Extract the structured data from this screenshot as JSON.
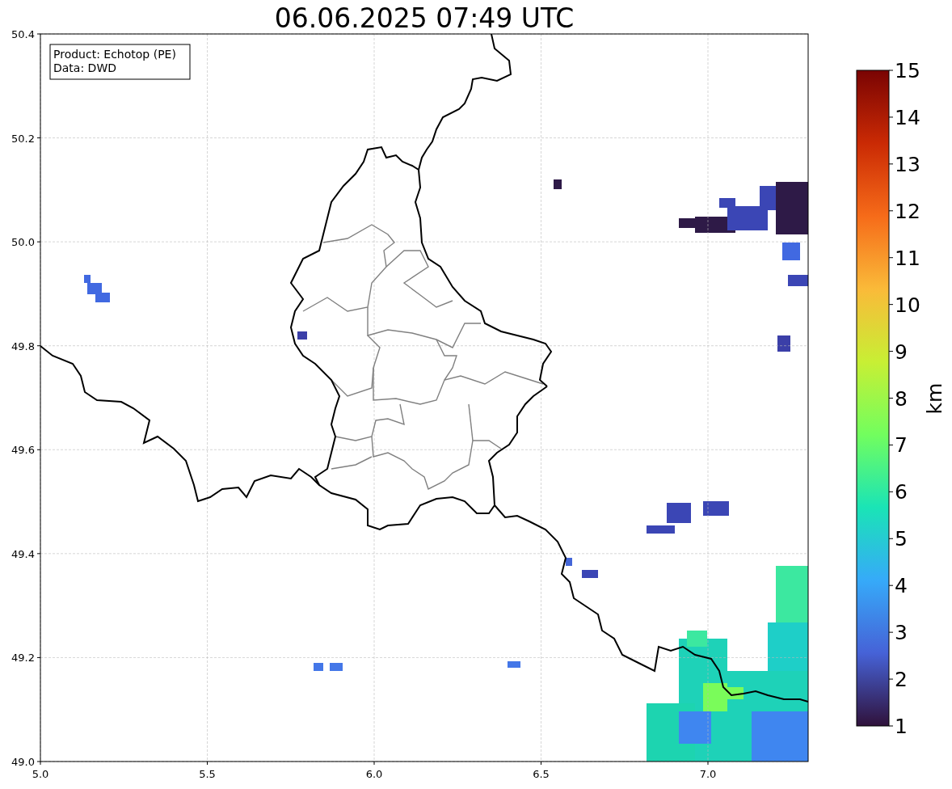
{
  "title": "06.06.2025 07:49 UTC",
  "info_box": {
    "lines": [
      "Product: Echotop (PE)",
      "Data: DWD"
    ]
  },
  "x_axis": {
    "ticks": [
      "5.0",
      "5.5",
      "6.0",
      "6.5",
      "7.0"
    ]
  },
  "y_axis": {
    "ticks": [
      "50.4",
      "50.2",
      "50.0",
      "49.8",
      "49.6",
      "49.4",
      "49.2",
      "49.0"
    ]
  },
  "colorbar": {
    "label": "km",
    "ticks": [
      "15",
      "14",
      "13",
      "12",
      "11",
      "10",
      "9",
      "8",
      "7",
      "6",
      "5",
      "4",
      "3",
      "2",
      "1"
    ]
  }
}
